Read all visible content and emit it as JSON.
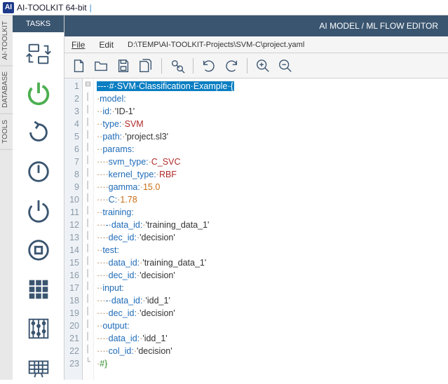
{
  "title": {
    "app": "AI-TOOLKIT 64-bit"
  },
  "side_tabs": [
    "AI-TOOLKIT",
    "DATABASE",
    "TOOLS"
  ],
  "sidebar": {
    "header": "TASKS"
  },
  "main_header": "AI MODEL / ML FLOW EDITOR",
  "menu": {
    "file": "File",
    "edit": "Edit",
    "path": "D:\\TEMP\\AI-TOOLKIT-Projects\\SVM-C\\project.yaml"
  },
  "code": {
    "lines": [
      {
        "n": 1,
        "sel": "---·#·SVM·Classification·Example·{"
      },
      {
        "n": 2,
        "dots": "·",
        "key": "model:"
      },
      {
        "n": 3,
        "dots": "··",
        "key": "id:",
        "sp": "·",
        "str": "'ID-1'"
      },
      {
        "n": 4,
        "dots": "··",
        "key": "type:",
        "sp": "·",
        "valClass": "val-red",
        "val": "SVM"
      },
      {
        "n": 5,
        "dots": "··",
        "key": "path:",
        "sp": "·",
        "str": "'project.sl3'"
      },
      {
        "n": 6,
        "dots": "··",
        "key": "params:"
      },
      {
        "n": 7,
        "dots": "····",
        "key": "svm_type:",
        "sp": "·",
        "valClass": "val-red",
        "val": "C_SVC"
      },
      {
        "n": 8,
        "dots": "····",
        "key": "kernel_type:",
        "sp": "·",
        "valClass": "val-red",
        "val": "RBF"
      },
      {
        "n": 9,
        "dots": "····",
        "key": "gamma:",
        "sp": "·",
        "valClass": "val-orange",
        "val": "15.0"
      },
      {
        "n": 10,
        "dots": "····",
        "key": "C:",
        "sp": "·",
        "valClass": "val-orange",
        "val": "1.78"
      },
      {
        "n": 11,
        "dots": "··",
        "key": "training:"
      },
      {
        "n": 12,
        "dots": "···",
        "key": "-·data_id:",
        "sp": "·",
        "str": "'training_data_1'"
      },
      {
        "n": 13,
        "dots": "····",
        "key": "dec_id:",
        "sp": "·",
        "str": "'decision'"
      },
      {
        "n": 14,
        "dots": "··",
        "key": "test:"
      },
      {
        "n": 15,
        "dots": "····",
        "key": "data_id:",
        "sp": "·",
        "str": "'training_data_1'"
      },
      {
        "n": 16,
        "dots": "····",
        "key": "dec_id:",
        "sp": "·",
        "str": "'decision'"
      },
      {
        "n": 17,
        "dots": "··",
        "key": "input:"
      },
      {
        "n": 18,
        "dots": "···",
        "key": "-·data_id:",
        "sp": "·",
        "str": "'idd_1'"
      },
      {
        "n": 19,
        "dots": "····",
        "key": "dec_id:",
        "sp": "·",
        "str": "'decision'"
      },
      {
        "n": 20,
        "dots": "··",
        "key": "output:"
      },
      {
        "n": 21,
        "dots": "····",
        "key": "data_id:",
        "sp": "·",
        "str": "'idd_1'"
      },
      {
        "n": 22,
        "dots": "····",
        "key": "col_id:",
        "sp": "·",
        "str": "'decision'"
      },
      {
        "n": 23,
        "dots": "",
        "hash": "#",
        "brace": "}"
      }
    ]
  }
}
